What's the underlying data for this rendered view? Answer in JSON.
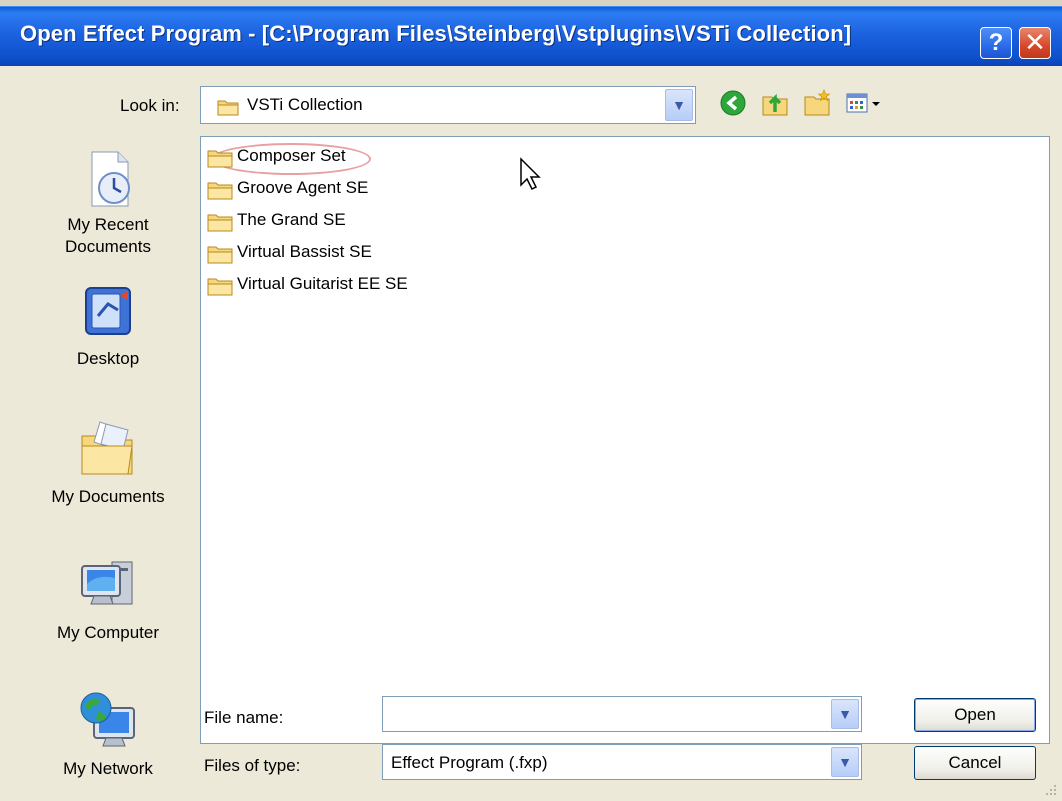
{
  "window": {
    "title": "Open Effect Program - [C:\\Program Files\\Steinberg\\Vstplugins\\VSTi Collection]",
    "help_symbol": "?",
    "close_symbol": "✕"
  },
  "lookin": {
    "label": "Look in:",
    "value": "VSTi Collection"
  },
  "places": [
    {
      "label_line1": "My Recent",
      "label_line2": "Documents",
      "icon": "recent-documents-icon"
    },
    {
      "label_line1": "Desktop",
      "label_line2": "",
      "icon": "desktop-icon"
    },
    {
      "label_line1": "My Documents",
      "label_line2": "",
      "icon": "my-documents-icon"
    },
    {
      "label_line1": "My Computer",
      "label_line2": "",
      "icon": "my-computer-icon"
    },
    {
      "label_line1": "My Network",
      "label_line2": "",
      "icon": "my-network-icon"
    }
  ],
  "files": [
    {
      "name": "Composer Set"
    },
    {
      "name": "Groove Agent SE"
    },
    {
      "name": "The Grand SE"
    },
    {
      "name": "Virtual Bassist SE"
    },
    {
      "name": "Virtual Guitarist EE SE"
    }
  ],
  "filename": {
    "label": "File name:",
    "value": ""
  },
  "filetype": {
    "label": "Files of type:",
    "value": "Effect Program (.fxp)"
  },
  "buttons": {
    "open": "Open",
    "cancel": "Cancel"
  },
  "colors": {
    "titlebar": "#0e50cc",
    "dialog_bg": "#ece9d8",
    "field_border": "#7f9db9"
  }
}
